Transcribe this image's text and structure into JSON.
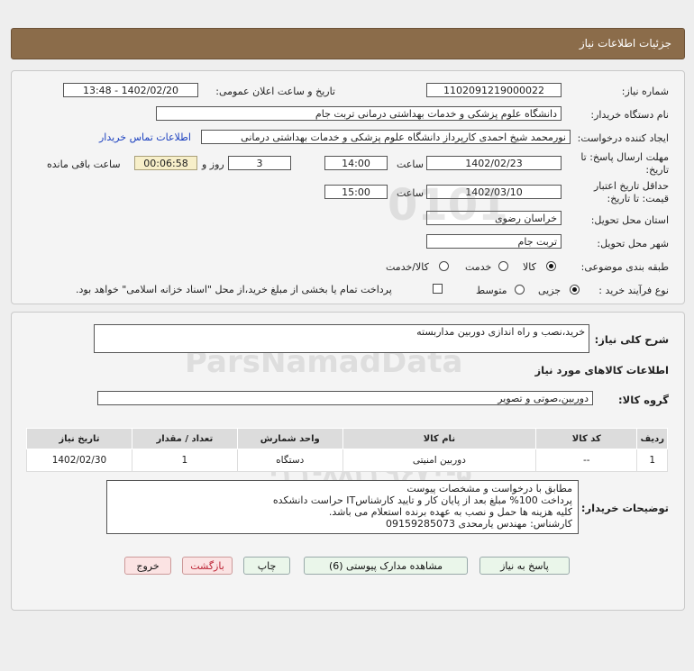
{
  "header": {
    "title": "جزئیات اطلاعات نیاز"
  },
  "fields": {
    "need_number_label": "شماره نیاز:",
    "need_number": "1102091219000022",
    "announce_label": "تاریخ و ساعت اعلان عمومی:",
    "announce_value": "1402/02/20 - 13:48",
    "buyer_org_label": "نام دستگاه خریدار:",
    "buyer_org": "دانشگاه علوم پزشکی و خدمات بهداشتی  درمانی تربت جام",
    "requester_label": "ایجاد کننده درخواست:",
    "requester": "نورمحمد شیخ احمدی کارپرداز دانشگاه علوم پزشکی و خدمات بهداشتی  درمانی",
    "contact_link": "اطلاعات تماس خریدار",
    "reply_deadline_label": "مهلت ارسال پاسخ: تا تاریخ:",
    "reply_date": "1402/02/23",
    "time_label": "ساعت",
    "reply_time": "14:00",
    "days_value": "3",
    "days_label": "روز و",
    "remaining_time": "00:06:58",
    "remaining_label": "ساعت باقی مانده",
    "validity_label": "حداقل تاریخ اعتبار قیمت: تا تاریخ:",
    "validity_date": "1402/03/10",
    "validity_time": "15:00",
    "province_label": "استان محل تحویل:",
    "province": "خراسان رضوی",
    "city_label": "شهر محل تحویل:",
    "city": "تربت جام",
    "category_label": "طبقه بندی موضوعی:",
    "category_options": [
      "کالا",
      "خدمت",
      "کالا/خدمت"
    ],
    "category_selected": 0,
    "process_label": "نوع فرآیند خرید :",
    "process_options": [
      "جزیی",
      "متوسط"
    ],
    "process_selected": 0,
    "payment_note": "پرداخت تمام یا بخشی از مبلغ خرید،از محل \"اسناد خزانه اسلامی\" خواهد بود."
  },
  "summary": {
    "label": "شرح کلی نیاز:",
    "value": "خرید،نصب و راه اندازی دوربین مداربسته"
  },
  "goods_info": {
    "title": "اطلاعات کالاهای مورد نیاز",
    "group_label": "گروه کالا:",
    "group_value": "دوربین،صوتی و تصویر"
  },
  "table": {
    "headers": [
      "ردیف",
      "کد کالا",
      "نام کالا",
      "واحد شمارش",
      "تعداد / مقدار",
      "تاریخ نیاز"
    ],
    "rows": [
      [
        "1",
        "--",
        "دوربین امنیتی",
        "دستگاه",
        "1",
        "1402/02/30"
      ]
    ]
  },
  "buyer_notes": {
    "label": "توضیحات خریدار:",
    "lines": [
      "مطابق با درخواست و مشخصات پیوست",
      "پرداخت 100% مبلغ بعد از پایان کار و تایید کارشناسIT حراست دانشکده",
      "کلیه هزینه ها حمل و نصب به عهده برنده استعلام می باشد.",
      "کارشناس: مهندس یارمحدی 09159285073"
    ]
  },
  "buttons": {
    "reply": "پاسخ به نیاز",
    "attachments": "مشاهده مدارک پیوستی (6)",
    "print": "چاپ",
    "back": "بازگشت",
    "exit": "خروج"
  },
  "colors": {
    "header_bg": "#8b6c4a",
    "link": "#1a3fbf"
  }
}
